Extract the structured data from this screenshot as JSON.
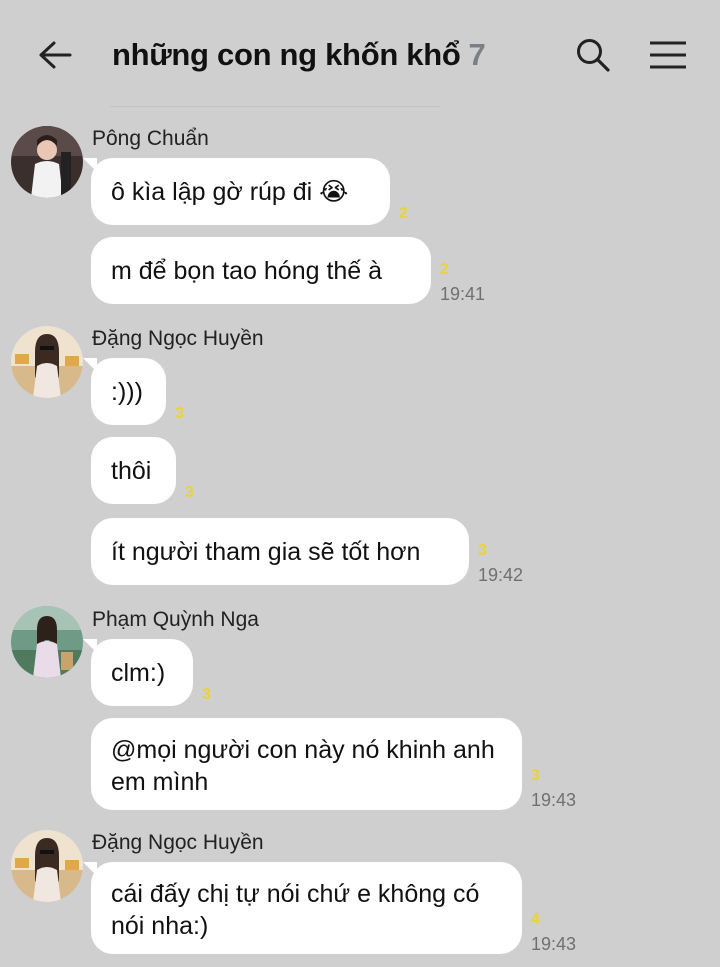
{
  "header": {
    "title": "những con ng khốn khổ",
    "member_count": "7"
  },
  "messages": [
    {
      "sender": "Pông Chuẩn",
      "bubbles": [
        {
          "text": "ô kìa lập gờ rúp đi 😭",
          "seen": "2"
        },
        {
          "text": "m để bọn tao hóng thế à",
          "seen": "2",
          "time": "19:41"
        }
      ]
    },
    {
      "sender": "Đặng Ngọc Huyền",
      "bubbles": [
        {
          "text": ":)))",
          "seen": "3"
        },
        {
          "text": "thôi",
          "seen": "3"
        },
        {
          "text": "ít người tham gia sẽ tốt hơn",
          "seen": "3",
          "time": "19:42"
        }
      ]
    },
    {
      "sender": "Phạm Quỳnh Nga",
      "bubbles": [
        {
          "text": "clm:)",
          "seen": "3"
        },
        {
          "text": "@mọi người con này nó khinh anh em mình",
          "seen": "3",
          "time": "19:43"
        }
      ]
    },
    {
      "sender": "Đặng Ngọc Huyền",
      "bubbles": [
        {
          "text": "cái đấy chị tự nói chứ e không có nói nha:)",
          "seen": "4",
          "time": "19:43"
        }
      ]
    }
  ],
  "icons": {
    "back": "arrow-left-icon",
    "search": "search-icon",
    "menu": "hamburger-menu-icon"
  },
  "colors": {
    "background": "#cfcfd0",
    "bubble": "#ffffff",
    "seen_count": "#e8d437",
    "member_count": "#7a7f86"
  }
}
